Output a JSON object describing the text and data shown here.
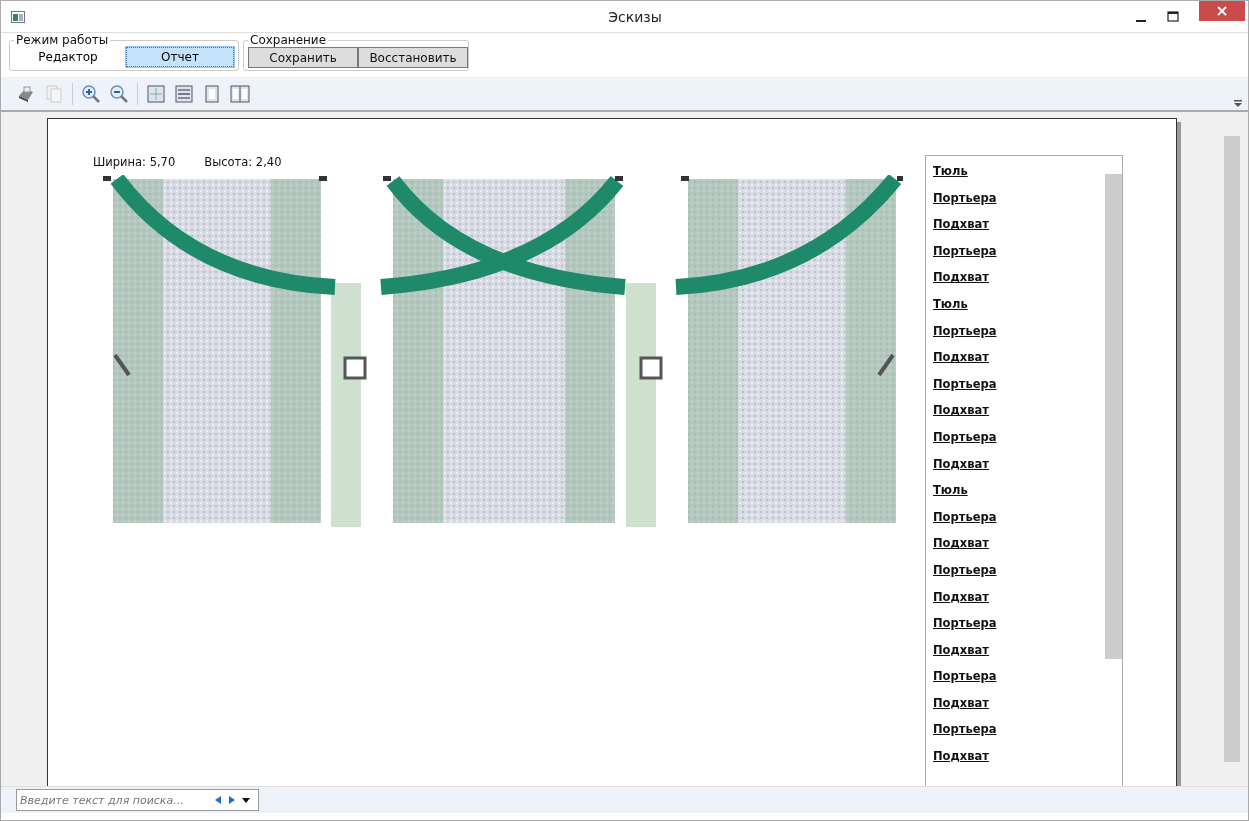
{
  "window": {
    "title": "Эскизы"
  },
  "mode_group": {
    "title": "Режим работы",
    "options": [
      {
        "label": "Редактор",
        "selected": false
      },
      {
        "label": "Отчет",
        "selected": true
      }
    ]
  },
  "save_group": {
    "title": "Сохранение",
    "buttons": [
      "Сохранить",
      "Восстановить"
    ]
  },
  "report": {
    "width_label": "Ширина: 5,70",
    "height_label": "Высота: 2,40"
  },
  "items": [
    {
      "label": "Тюль"
    },
    {
      "label": "Портьера"
    },
    {
      "label": "Подхват"
    },
    {
      "label": "Портьера"
    },
    {
      "label": "Подхват"
    },
    {
      "label": "Тюль"
    },
    {
      "label": "Портьера"
    },
    {
      "label": "Подхват"
    },
    {
      "label": "Портьера"
    },
    {
      "label": "Подхват"
    },
    {
      "label": "Портьера"
    },
    {
      "label": "Подхват"
    },
    {
      "label": "Тюль"
    },
    {
      "label": "Портьера"
    },
    {
      "label": "Подхват"
    },
    {
      "label": "Портьера"
    },
    {
      "label": "Подхват"
    },
    {
      "label": "Портьера"
    },
    {
      "label": "Подхват"
    },
    {
      "label": "Портьера"
    },
    {
      "label": "Подхват"
    },
    {
      "label": "Портьера"
    },
    {
      "label": "Подхват"
    }
  ],
  "search": {
    "placeholder": "Введите текст для поиска..."
  }
}
